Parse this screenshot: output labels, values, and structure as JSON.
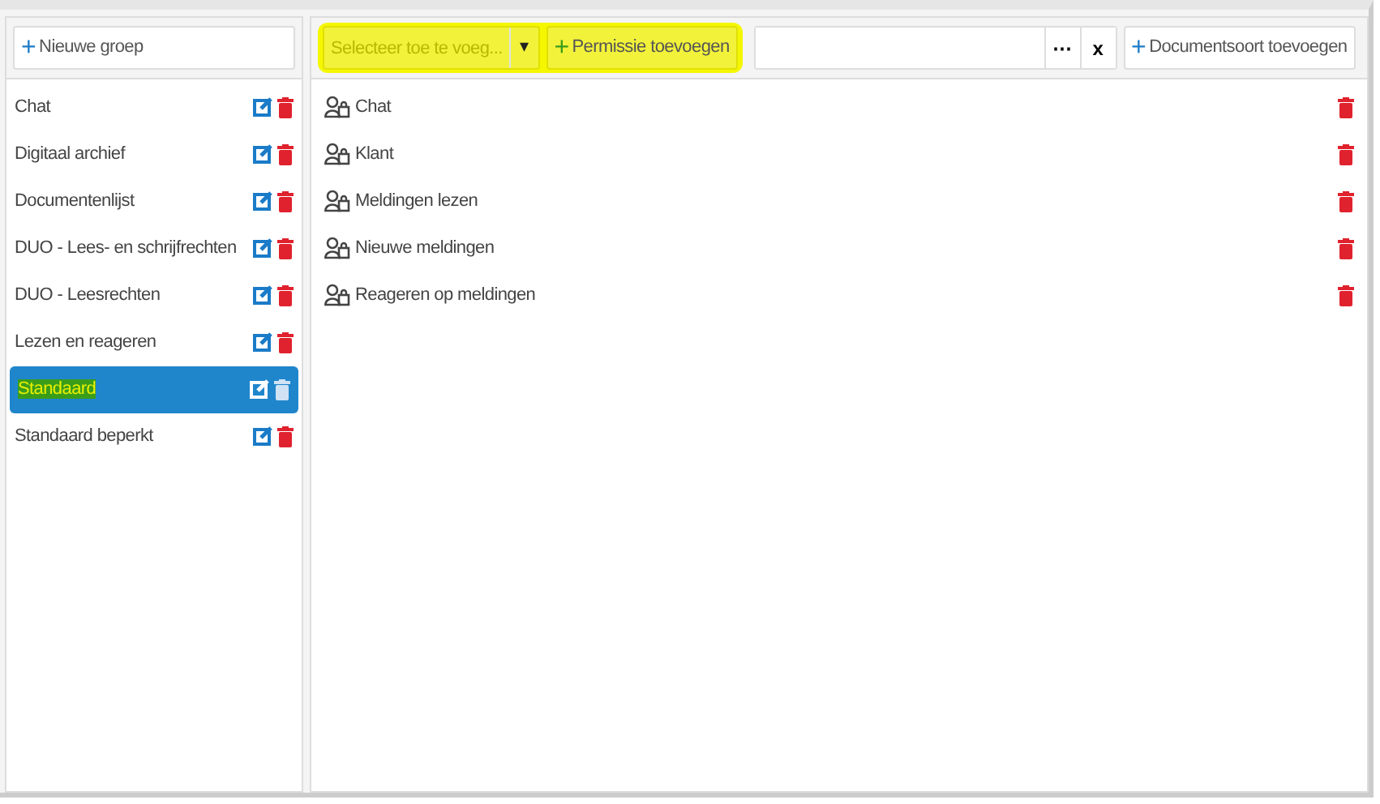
{
  "new_group_button": {
    "icon": "+",
    "label": "Nieuwe groep"
  },
  "groups": [
    {
      "name": "Chat",
      "selected": false
    },
    {
      "name": "Digitaal archief",
      "selected": false
    },
    {
      "name": "Documentenlijst",
      "selected": false
    },
    {
      "name": "DUO - Lees- en schrijfrechten",
      "selected": false
    },
    {
      "name": "DUO - Leesrechten",
      "selected": false
    },
    {
      "name": "Lezen en reageren",
      "selected": false
    },
    {
      "name": "Standaard",
      "selected": true,
      "highlighted": true
    },
    {
      "name": "Standaard beperkt",
      "selected": false
    }
  ],
  "toolbar": {
    "highlighted": true,
    "permission_select": {
      "placeholder": "Selecteer toe te voeg...",
      "caret": "▾"
    },
    "add_permission_button": {
      "icon": "+",
      "label": "Permissie toevoegen"
    },
    "document_type_field": {
      "browse": "⋯",
      "clear": "x"
    },
    "add_document_type_button": {
      "icon": "+",
      "label": "Documentsoort toevoegen"
    }
  },
  "permissions": [
    {
      "name": "Chat"
    },
    {
      "name": "Klant"
    },
    {
      "name": "Meldingen lezen"
    },
    {
      "name": "Nieuwe meldingen"
    },
    {
      "name": "Reageren op meldingen"
    }
  ]
}
